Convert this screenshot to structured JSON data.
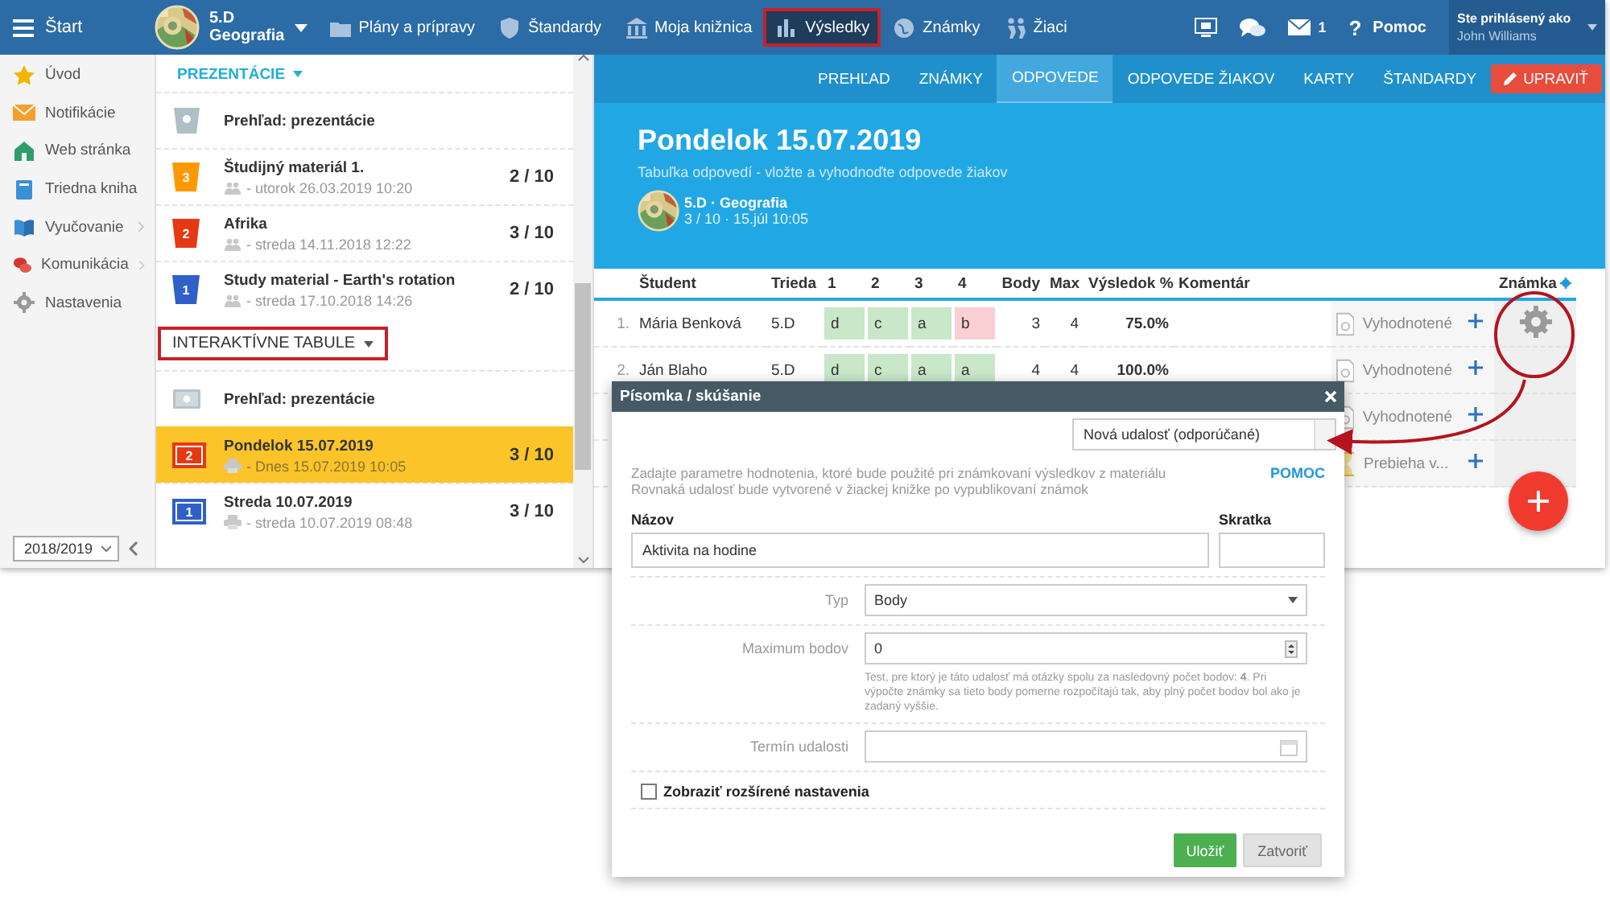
{
  "topbar": {
    "menu_label": "Štart",
    "class": {
      "name": "5.D",
      "subject": "Geografia"
    },
    "nav": [
      {
        "label": "Plány a prípravy",
        "selected": false,
        "highlighted": false
      },
      {
        "label": "Štandardy",
        "selected": false,
        "highlighted": false
      },
      {
        "label": "Moja knižnica",
        "selected": false,
        "highlighted": false
      },
      {
        "label": "Výsledky",
        "selected": true,
        "highlighted": true
      },
      {
        "label": "Známky",
        "selected": false,
        "highlighted": false
      },
      {
        "label": "Žiaci",
        "selected": false,
        "highlighted": false
      }
    ],
    "messages_count": "1",
    "help_icon": "?",
    "help_label": "Pomoc",
    "user": {
      "caption": "Ste prihlásený ako",
      "name": "John Williams"
    }
  },
  "sidebar": {
    "items": [
      {
        "label": "Úvod",
        "has_submenu": false
      },
      {
        "label": "Notifikácie",
        "has_submenu": false
      },
      {
        "label": "Web stránka",
        "has_submenu": false
      },
      {
        "label": "Triedna kniha",
        "has_submenu": false
      },
      {
        "label": "Vyučovanie",
        "has_submenu": true
      },
      {
        "label": "Komunikácia",
        "has_submenu": true
      },
      {
        "label": "Nastavenia",
        "has_submenu": false
      }
    ],
    "school_year": "2018/2019"
  },
  "materials": {
    "sections": [
      {
        "title": "PREZENTÁCIE",
        "kind": "presentation",
        "active": true,
        "highlighted": false,
        "items": [
          {
            "kind": "overview",
            "title": "Prehľad: prezentácie",
            "selected": false
          },
          {
            "kind": "material",
            "badge": "3",
            "color": "#ff9800",
            "title": "Študijný materiál 1.",
            "meta": "- utorok 26.03.2019 10:20",
            "score": "2 / 10",
            "selected": false
          },
          {
            "kind": "material",
            "badge": "2",
            "color": "#e53914",
            "title": "Afrika",
            "meta": "- streda 14.11.2018 12:22",
            "score": "3 / 10",
            "selected": false
          },
          {
            "kind": "material",
            "badge": "1",
            "color": "#2f5fc8",
            "title": "Study material - Earth's rotation",
            "meta": "- streda 17.10.2018 14:26",
            "score": "2 / 10",
            "selected": false
          }
        ]
      },
      {
        "title": "INTERAKTÍVNE TABULE",
        "kind": "board",
        "active": false,
        "highlighted": true,
        "items": [
          {
            "kind": "overview",
            "title": "Prehľad: prezentácie",
            "selected": false
          },
          {
            "kind": "material",
            "badge": "2",
            "color": "#e53914",
            "title": "Pondelok 15.07.2019",
            "meta": "- Dnes 15.07.2019 10:05",
            "score": "3 / 10",
            "selected": true
          },
          {
            "kind": "material",
            "badge": "1",
            "color": "#2f5fc8",
            "title": "Streda 10.07.2019",
            "meta": "- streda 10.07.2019 08:48",
            "score": "3 / 10",
            "selected": false
          }
        ]
      }
    ]
  },
  "lesson": {
    "tabs": [
      {
        "label": "PREHĽAD",
        "selected": false
      },
      {
        "label": "ZNÁMKY",
        "selected": false
      },
      {
        "label": "ODPOVEDE",
        "selected": true
      },
      {
        "label": "ODPOVEDE ŽIAKOV",
        "selected": false
      },
      {
        "label": "KARTY",
        "selected": false
      },
      {
        "label": "ŠTANDARDY",
        "selected": false
      }
    ],
    "edit_button": "UPRAVIŤ",
    "title": "Pondelok 15.07.2019",
    "subtitle": "Tabuľka odpovedí - vložte a vyhodnoďte odpovede žiakov",
    "class_label": "5.D · Geografia",
    "class_meta": "3 / 10 · 15.júl 10:05"
  },
  "table": {
    "columns": [
      "Študent",
      "Trieda",
      "1",
      "2",
      "3",
      "4",
      "Body",
      "Max",
      "Výsledok %",
      "Komentár",
      "Známka"
    ],
    "rows": [
      {
        "number": "1.",
        "student": "Mária Benková",
        "class": "5.D",
        "answers": [
          {
            "value": "d",
            "correct": true
          },
          {
            "value": "c",
            "correct": true
          },
          {
            "value": "a",
            "correct": true
          },
          {
            "value": "b",
            "correct": false
          }
        ],
        "points": "3",
        "max": "4",
        "result": "75.0%",
        "status": "Vyhodnotené",
        "kind": "evaluated"
      },
      {
        "number": "2.",
        "student": "Ján Blaho",
        "class": "5.D",
        "answers": [
          {
            "value": "d",
            "correct": true
          },
          {
            "value": "c",
            "correct": true
          },
          {
            "value": "a",
            "correct": true
          },
          {
            "value": "a",
            "correct": true
          }
        ],
        "points": "4",
        "max": "4",
        "result": "100.0%",
        "status": "Vyhodnotené",
        "kind": "evaluated"
      },
      {
        "status": "Vyhodnotené",
        "kind": "evaluated"
      },
      {
        "status": "Prebieha v...",
        "kind": "in_progress"
      }
    ]
  },
  "dialog": {
    "title": "Písomka / skúšanie",
    "event_select": "Nová udalosť (odporúčané)",
    "description": [
      "Zadajte parametre hodnotenia, ktoré bude použité pri známkovaní výsledkov z materiálu",
      "Rovnaká udalosť bude vytvorené v žiackej knižke po vypublikovaní známok"
    ],
    "help_link": "POMOC",
    "name_label": "Názov",
    "name_value": "Aktivita na hodine",
    "short_label": "Skratka",
    "fields": [
      {
        "kind": "select",
        "label": "Typ",
        "value": "Body"
      },
      {
        "kind": "number",
        "label": "Maximum bodov",
        "value": "0",
        "hint": "Test, pre ktorý je táto udalosť má otázky spolu za nasledovný počet bodov: **4**. Pri výpočte známky sa tieto body pomerne rozpočítajú tak, aby plný počet bodov bol ako je zadaný vyššie."
      },
      {
        "kind": "date",
        "label": "Termín udalosti"
      }
    ],
    "advanced": {
      "label": "Zobraziť rozšírené nastavenia",
      "checked": false
    },
    "buttons": [
      {
        "label": "Uložiť",
        "kind": "primary"
      },
      {
        "label": "Zatvoriť",
        "kind": "secondary"
      }
    ]
  }
}
